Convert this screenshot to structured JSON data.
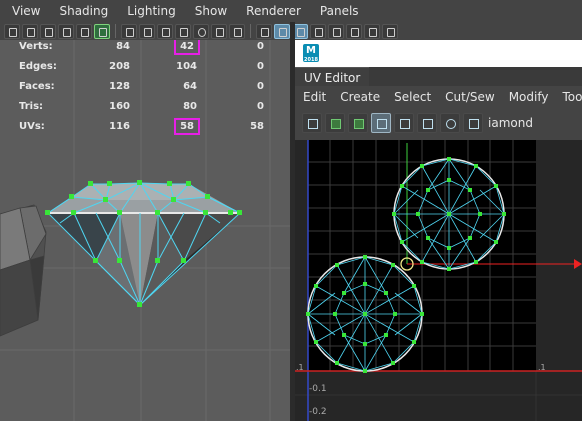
{
  "viewport": {
    "menu": [
      "View",
      "Shading",
      "Lighting",
      "Show",
      "Renderer",
      "Panels"
    ]
  },
  "hud": {
    "rows": [
      {
        "label": "Verts:",
        "v1": "84",
        "v2": "42",
        "v3": "0"
      },
      {
        "label": "Edges:",
        "v1": "208",
        "v2": "104",
        "v3": "0"
      },
      {
        "label": "Faces:",
        "v1": "128",
        "v2": "64",
        "v3": "0"
      },
      {
        "label": "Tris:",
        "v1": "160",
        "v2": "80",
        "v3": "0"
      },
      {
        "label": "UVs:",
        "v1": "116",
        "v2": "58",
        "v3": "58"
      }
    ]
  },
  "uv_editor": {
    "logo": "M",
    "logo_sub": "2018",
    "tab_label": "UV Editor",
    "menu": [
      "Edit",
      "Create",
      "Select",
      "Cut/Sew",
      "Modify",
      "Tools"
    ],
    "object_name": "iamond",
    "axis_labels": {
      "x_left": ".1",
      "x_right": ".1",
      "y1": "-0.1",
      "y2": "-0.2"
    }
  },
  "colors": {
    "highlight": "#e61fe6",
    "wire": "#4fd6f2",
    "vertex": "#39e639",
    "uv_bg": "#000000"
  }
}
